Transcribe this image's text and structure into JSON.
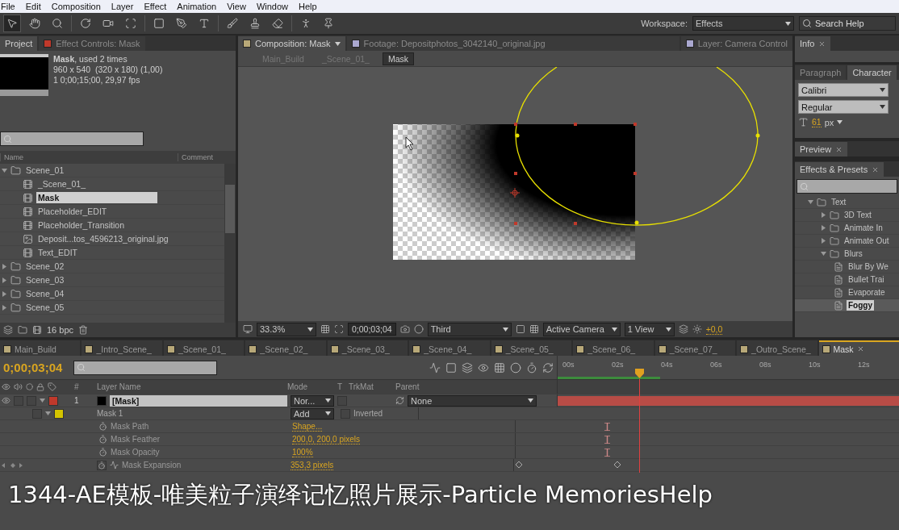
{
  "menu": [
    "File",
    "Edit",
    "Composition",
    "Layer",
    "Effect",
    "Animation",
    "View",
    "Window",
    "Help"
  ],
  "toolbar": {
    "workspace_label": "Workspace:",
    "workspace": "Effects",
    "search_placeholder": "Search Help"
  },
  "project": {
    "tabs": [
      {
        "label": "Project",
        "selected": true
      },
      {
        "label": "Effect Controls: Mask",
        "selected": false
      }
    ],
    "name": "Mask",
    "usage": ", used 2 times",
    "dimensions": "960 x 540  (320 x 180) (1,00)",
    "duration": "1 0;00;15;00, 29,97 fps",
    "columns": [
      "Name",
      "Comment"
    ],
    "items": [
      {
        "kind": "folder",
        "label": "Scene_01",
        "expanded": true,
        "selected": false,
        "children": [
          {
            "kind": "comp",
            "label": "_Scene_01_",
            "selected": false
          },
          {
            "kind": "comp",
            "label": "Mask",
            "selected": true
          },
          {
            "kind": "comp",
            "label": "Placeholder_EDIT",
            "selected": false
          },
          {
            "kind": "comp",
            "label": "Placeholder_Transition",
            "selected": false
          },
          {
            "kind": "image",
            "label": "Deposit...tos_4596213_original.jpg",
            "selected": false
          },
          {
            "kind": "comp",
            "label": "Text_EDIT",
            "selected": false
          }
        ]
      },
      {
        "kind": "folder",
        "label": "Scene_02",
        "expanded": false,
        "selected": false
      },
      {
        "kind": "folder",
        "label": "Scene_03",
        "expanded": false,
        "selected": false
      },
      {
        "kind": "folder",
        "label": "Scene_04",
        "expanded": false,
        "selected": false
      },
      {
        "kind": "folder",
        "label": "Scene_05",
        "expanded": false,
        "selected": false
      }
    ],
    "bit_depth": "16 bpc"
  },
  "viewer": {
    "tabs": [
      {
        "label": "Composition: Mask",
        "selected": true
      },
      {
        "label": "Footage: Depositphotos_3042140_original.jpg",
        "selected": false
      },
      {
        "label": "Layer: Camera Control",
        "selected": false
      }
    ],
    "breadcrumbs": [
      {
        "label": "Main_Build",
        "selected": false
      },
      {
        "label": "_Scene_01_",
        "selected": false
      },
      {
        "label": "Mask",
        "selected": true
      }
    ],
    "zoom": "33.3%",
    "time": "0;00;03;04",
    "resolution": "Third",
    "camera": "Active Camera",
    "views": "1 View",
    "exposure": "+0,0"
  },
  "panels": {
    "info_tab": "Info",
    "char_tabs": [
      {
        "label": "Paragraph",
        "selected": false
      },
      {
        "label": "Character",
        "selected": true
      }
    ],
    "font": "Calibri",
    "style": "Regular",
    "size": "61",
    "size_unit": "px",
    "preview_tab": "Preview",
    "effects_tab": "Effects & Presets",
    "effects": [
      {
        "kind": "folder",
        "label": "Text",
        "expanded": true,
        "selected": false,
        "children": [
          {
            "kind": "folder",
            "label": "3D Text",
            "expanded": false,
            "selected": false
          },
          {
            "kind": "folder",
            "label": "Animate In",
            "expanded": false,
            "selected": false
          },
          {
            "kind": "folder",
            "label": "Animate Out",
            "expanded": false,
            "selected": false
          },
          {
            "kind": "folder",
            "label": "Blurs",
            "expanded": true,
            "selected": false,
            "children": [
              {
                "kind": "preset",
                "label": "Blur By We",
                "selected": false
              },
              {
                "kind": "preset",
                "label": "Bullet Trai",
                "selected": false
              },
              {
                "kind": "preset",
                "label": "Evaporate",
                "selected": false
              },
              {
                "kind": "preset",
                "label": "Foggy",
                "selected": true
              }
            ]
          }
        ]
      }
    ]
  },
  "timeline": {
    "tabs": [
      {
        "label": "Main_Build",
        "selected": false
      },
      {
        "label": "_Intro_Scene_",
        "selected": false
      },
      {
        "label": "_Scene_01_",
        "selected": false
      },
      {
        "label": "_Scene_02_",
        "selected": false
      },
      {
        "label": "_Scene_03_",
        "selected": false
      },
      {
        "label": "_Scene_04_",
        "selected": false
      },
      {
        "label": "_Scene_05_",
        "selected": false
      },
      {
        "label": "_Scene_06_",
        "selected": false
      },
      {
        "label": "_Scene_07_",
        "selected": false
      },
      {
        "label": "_Outro_Scene_",
        "selected": false
      },
      {
        "label": "Mask",
        "selected": true
      }
    ],
    "time": "0;00;03;04",
    "columns": [
      "#",
      "Layer Name",
      "Mode",
      "T",
      "TrkMat",
      "Parent"
    ],
    "layer": {
      "number": "1",
      "name": "[Mask]",
      "mode": "Nor...",
      "parent": "None"
    },
    "mask": {
      "name": "Mask 1",
      "mode": "Add",
      "inverted": false,
      "inverted_label": "Inverted"
    },
    "properties": [
      {
        "name": "Mask Path",
        "value": "Shape...",
        "animated": false
      },
      {
        "name": "Mask Feather",
        "value": "200,0, 200,0 pixels",
        "animated": false
      },
      {
        "name": "Mask Opacity",
        "value": "100%",
        "animated": false
      },
      {
        "name": "Mask Expansion",
        "value": "353,3 pixels",
        "animated": true
      }
    ],
    "ruler": {
      "labels": [
        "00s",
        "02s",
        "04s",
        "06s",
        "08s",
        "10s",
        "12s"
      ],
      "level": 0.238
    }
  },
  "caption": "1344-AE模板-唯美粒子演绎记忆照片展示-Particle MemoriesHelp"
}
